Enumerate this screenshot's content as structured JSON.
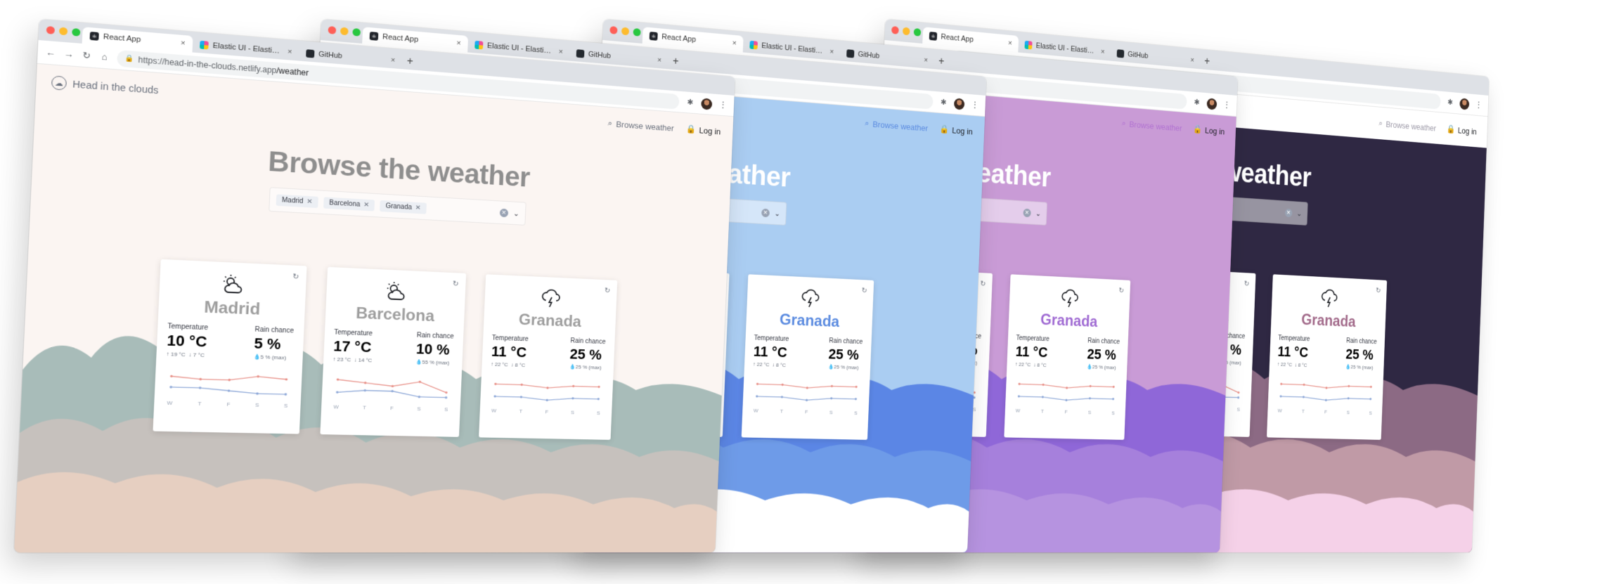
{
  "browser": {
    "tabs": [
      {
        "label": "React App",
        "icon": "react-favicon",
        "active": true
      },
      {
        "label": "Elastic UI - Elastic UI Framework",
        "icon": "elastic-favicon",
        "active": false
      },
      {
        "label": "GitHub",
        "icon": "github-favicon",
        "active": false
      }
    ],
    "tab_close": "×",
    "new_tab": "+",
    "url_host": "https://head-in-the-clouds.netlify.app",
    "url_path": "/weather"
  },
  "app": {
    "brand": "Head in the clouds",
    "nav_browse": "Browse weather",
    "login": "Log in"
  },
  "hero": {
    "title": "Browse the weather"
  },
  "selected_cities": [
    {
      "label": "Madrid"
    },
    {
      "label": "Barcelona"
    },
    {
      "label": "Granada"
    }
  ],
  "labels": {
    "temperature": "Temperature",
    "rain_chance": "Rain chance"
  },
  "cards": [
    {
      "city": "Madrid",
      "icon": "cloudy-sun-icon",
      "temp": "10 °C",
      "temp_max": "↑ 19 °C",
      "temp_min": "↓ 7 °C",
      "rain": "5 %",
      "rain_max": "💧5 % (max)",
      "days": [
        "W",
        "T",
        "F",
        "S",
        "S"
      ],
      "series_high": [
        14,
        13,
        13,
        15,
        14
      ],
      "series_low": [
        9,
        9,
        8,
        7,
        7
      ]
    },
    {
      "city": "Barcelona",
      "icon": "cloudy-sun-icon",
      "temp": "17 °C",
      "temp_max": "↑ 23 °C",
      "temp_min": "↓ 14 °C",
      "rain": "10 %",
      "rain_max": "💧55 % (max)",
      "days": [
        "W",
        "T",
        "F",
        "S",
        "S"
      ],
      "series_high": [
        16,
        15,
        14,
        16,
        12
      ],
      "series_low": [
        11,
        12,
        12,
        10,
        10
      ]
    },
    {
      "city": "Granada",
      "icon": "thunderstorm-icon",
      "temp": "11 °C",
      "temp_max": "↑ 22 °C",
      "temp_min": "↓ 8 °C",
      "rain": "25 %",
      "rain_max": "💧25 % (max)",
      "days": [
        "W",
        "T",
        "F",
        "S",
        "S"
      ],
      "series_high": [
        15,
        15,
        14,
        15,
        15
      ],
      "series_low": [
        10,
        10,
        9,
        10,
        10
      ]
    }
  ],
  "themes": {
    "light": {
      "cloud_back": "#a8bcb9",
      "cloud_mid": "#c6c1bd",
      "cloud_front": "#e6cfc1",
      "high_line": "#e8928a",
      "low_line": "#8fa9d8"
    },
    "blue": {
      "cloud_back": "#5b86e5",
      "cloud_mid": "#6e9be8",
      "cloud_front": "#ffffff",
      "high_line": "#e8928a",
      "low_line": "#8fa9d8"
    },
    "purple": {
      "cloud_back": "#8f67d8",
      "cloud_mid": "#a680dc",
      "cloud_front": "#b693e0",
      "high_line": "#e8928a",
      "low_line": "#8fa9d8"
    },
    "dark": {
      "cloud_back": "#8c6a84",
      "cloud_mid": "#c09aa6",
      "cloud_front": "#f5d1e8",
      "high_line": "#e8928a",
      "low_line": "#8fa9d8"
    }
  }
}
